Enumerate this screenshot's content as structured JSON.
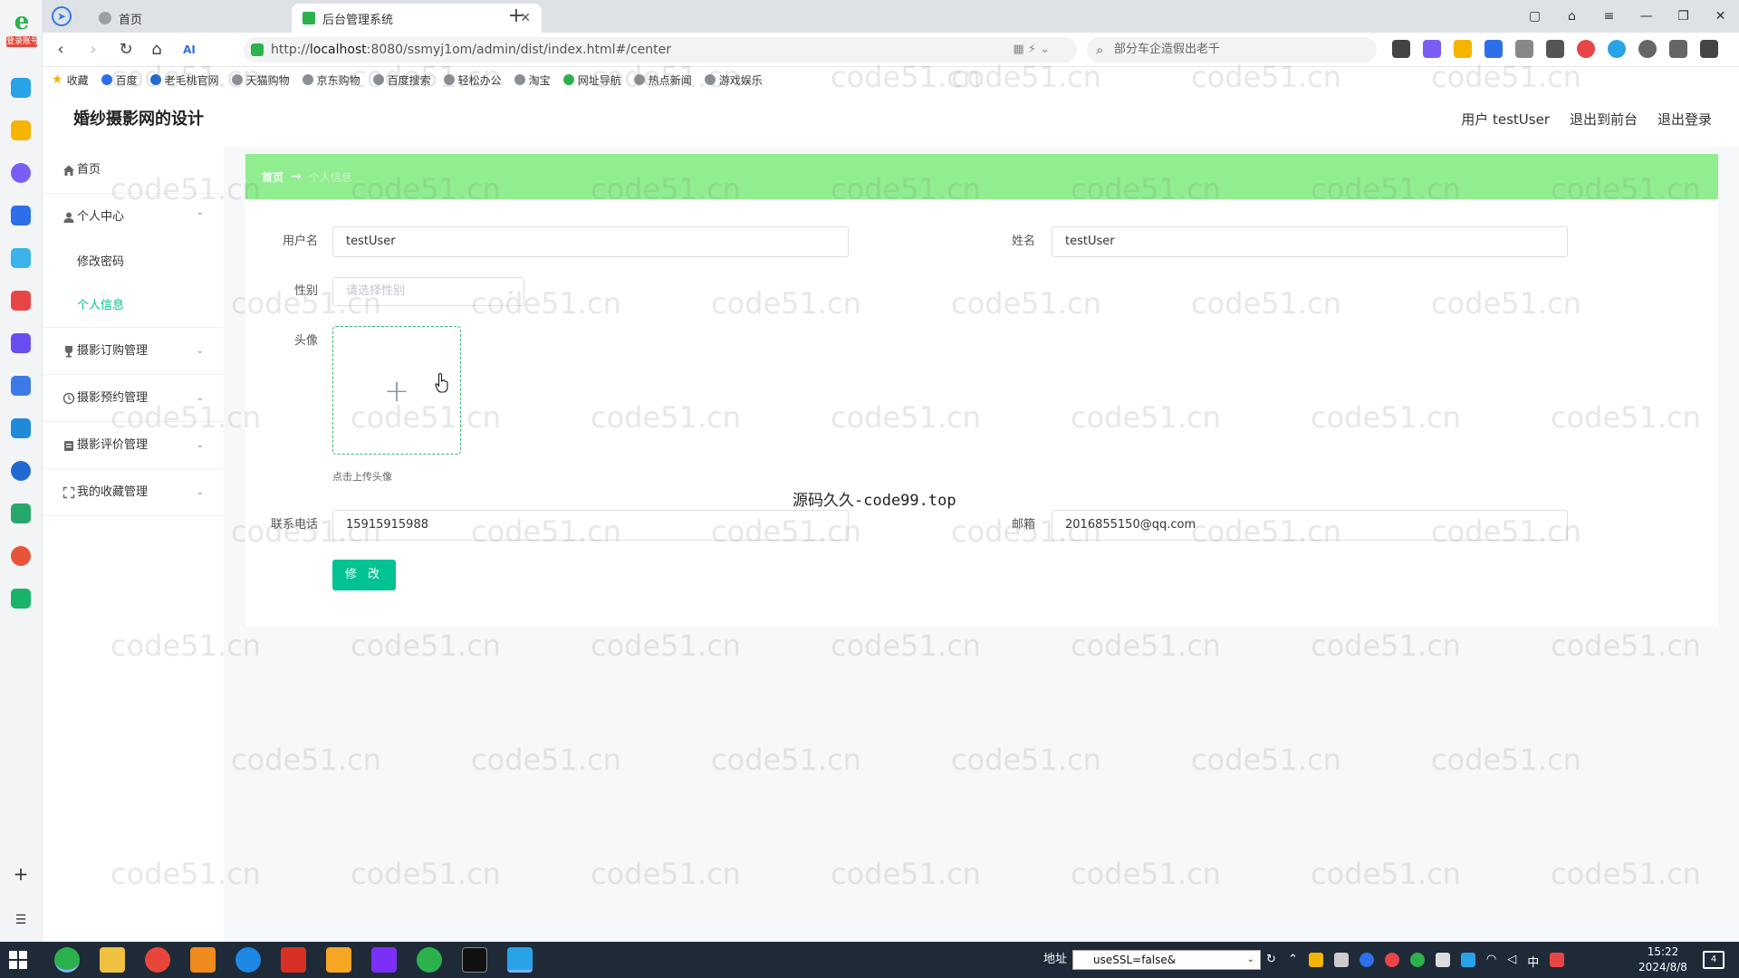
{
  "browser": {
    "tabs": [
      {
        "label": "首页",
        "active": false
      },
      {
        "label": "后台管理系统",
        "active": true
      }
    ],
    "url_scheme": "http://",
    "url_host": "localhost",
    "url_rest": ":8080/ssmyj1om/admin/dist/index.html#/center",
    "search_text": "部分车企造假出老千",
    "bookmarks": [
      "收藏",
      "百度",
      "老毛桃官网",
      "天猫购物",
      "京东购物",
      "百度搜索",
      "轻松办公",
      "淘宝",
      "网址导航",
      "热点新闻",
      "游戏娱乐"
    ],
    "rail_tag": "登录账号"
  },
  "header": {
    "site_title": "婚纱摄影网的设计",
    "user_label": "用户 testUser",
    "front_link": "退出到前台",
    "logout_link": "退出登录"
  },
  "sidebar": {
    "home": "首页",
    "personal_center": "个人中心",
    "change_password": "修改密码",
    "personal_info": "个人信息",
    "order_mgmt": "摄影订购管理",
    "booking_mgmt": "摄影预约管理",
    "review_mgmt": "摄影评价管理",
    "favorite_mgmt": "我的收藏管理"
  },
  "breadcrumb": {
    "home": "首页",
    "separator": "→",
    "current": "个人信息"
  },
  "form": {
    "username_label": "用户名",
    "username_value": "testUser",
    "name_label": "姓名",
    "name_value": "testUser",
    "gender_label": "性别",
    "gender_placeholder": "请选择性别",
    "avatar_label": "头像",
    "avatar_plus": "+",
    "avatar_tip": "点击上传头像",
    "phone_label": "联系电话",
    "phone_value": "15915915988",
    "email_label": "邮箱",
    "email_value": "2016855150@qq.com",
    "submit_label": "修 改"
  },
  "watermark": {
    "source_text": "源码久久-code99.top",
    "tile_text": "code51.cn"
  },
  "taskbar": {
    "addr_label": "地址",
    "addr_value": "useSSL=false&",
    "ime_label": "中",
    "time": "15:22",
    "date": "2024/8/8",
    "notif_count": "4"
  },
  "colors": {
    "accent": "#00c292",
    "breadcrumb_bg": "#90ee90",
    "upload_border": "#3cb371"
  }
}
